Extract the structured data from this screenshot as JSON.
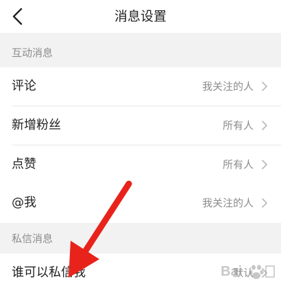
{
  "header": {
    "title": "消息设置",
    "back_icon": "chevron-left-icon"
  },
  "sections": [
    {
      "title": "互动消息",
      "items": [
        {
          "label": "评论",
          "value": "我关注的人"
        },
        {
          "label": "新增粉丝",
          "value": "所有人"
        },
        {
          "label": "点赞",
          "value": "所有人"
        },
        {
          "label": "@我",
          "value": "我关注的人"
        }
      ]
    },
    {
      "title": "私信消息",
      "items": [
        {
          "label": "谁可以私信我",
          "value": "默认"
        }
      ]
    }
  ],
  "annotation": {
    "type": "red-arrow",
    "color": "#e8231b"
  },
  "watermark": {
    "text": "Bai"
  },
  "colors": {
    "background": "#f2f2f2",
    "row": "#ffffff",
    "secondary_text": "#8c8c8c",
    "arrow": "#e8231b"
  }
}
